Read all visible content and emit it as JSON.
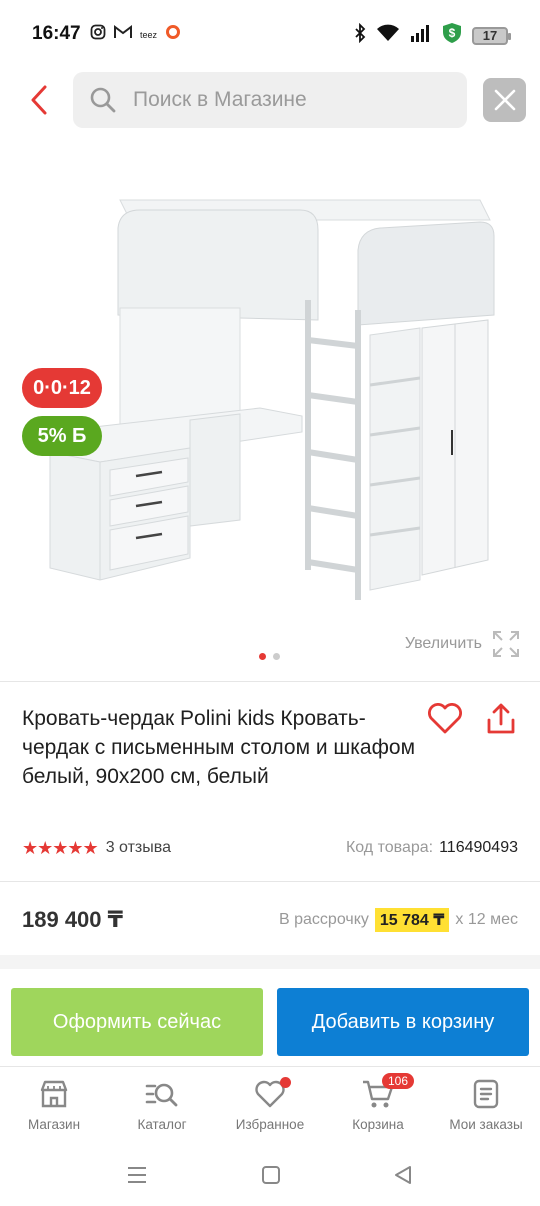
{
  "status_bar": {
    "time": "16:47",
    "teez_label": "teez",
    "battery": "17",
    "icons": [
      "instagram-icon",
      "gmail-icon",
      "teez-icon",
      "circle-app-icon",
      "bluetooth-icon",
      "wifi-icon",
      "signal-icon",
      "dollar-shield-icon",
      "battery-icon"
    ]
  },
  "header": {
    "search_placeholder": "Поиск в Магазине",
    "icons": [
      "back-icon",
      "search-icon",
      "close-icon"
    ]
  },
  "gallery": {
    "badge_installment": "0·0·12",
    "badge_bonus": "5% Б",
    "zoom_label": "Увеличить",
    "images_count": 2,
    "active_image": 1
  },
  "product": {
    "title": "Кровать-чердак Polini kids Кровать-чердак с письменным столом и шкафом белый, 90x200 см, белый",
    "stars": "★★★★★",
    "rating": 5,
    "reviews": "3 отзыва",
    "sku_label": "Код товара:",
    "sku_value": "116490493",
    "price": "189 400 ₸",
    "installment_prefix": "В рассрочку",
    "installment_amount": "15 784 ₸",
    "installment_suffix": "х 12 мес"
  },
  "actions": {
    "checkout": "Оформить сейчас",
    "add_to_cart": "Добавить в корзину"
  },
  "bottom_nav": {
    "items": [
      {
        "label": "Магазин",
        "icon": "store-icon"
      },
      {
        "label": "Каталог",
        "icon": "catalog-icon"
      },
      {
        "label": "Избранное",
        "icon": "heart-icon"
      },
      {
        "label": "Корзина",
        "icon": "cart-icon",
        "badge": "106"
      },
      {
        "label": "Мои заказы",
        "icon": "orders-icon"
      }
    ]
  },
  "colors": {
    "accent_red": "#e53935",
    "checkout_green": "#9fd65c",
    "cart_blue": "#0d7fd4",
    "installment_yellow": "#ffe033",
    "bonus_green": "#5aa81f"
  }
}
